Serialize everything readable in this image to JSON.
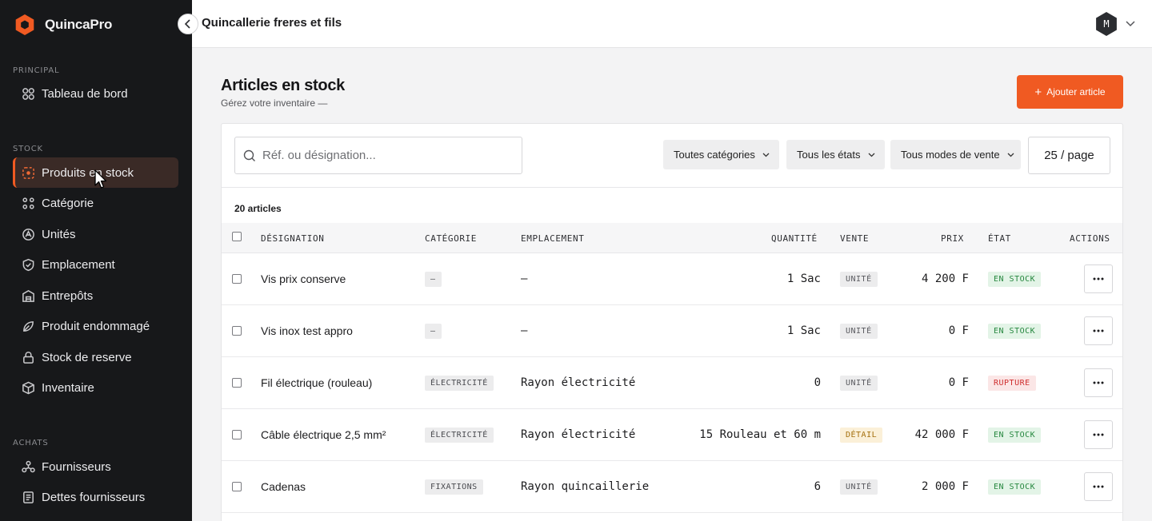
{
  "app": {
    "name": "QuincaPro",
    "brand_color": "#f05a22"
  },
  "header": {
    "store_name": "Quincallerie freres et fils",
    "avatar_initial": "M"
  },
  "sidebar": {
    "sections": [
      {
        "label": "PRINCIPAL",
        "items": [
          {
            "label": "Tableau de bord",
            "icon": "dashboard-icon"
          }
        ]
      },
      {
        "label": "STOCK",
        "items": [
          {
            "label": "Produits en stock",
            "icon": "box-icon",
            "active": true
          },
          {
            "label": "Catégorie",
            "icon": "category-icon"
          },
          {
            "label": "Unités",
            "icon": "units-icon"
          },
          {
            "label": "Emplacement",
            "icon": "location-icon"
          },
          {
            "label": "Entrepôts",
            "icon": "warehouse-icon"
          },
          {
            "label": "Produit endommagé",
            "icon": "damaged-icon"
          },
          {
            "label": "Stock de reserve",
            "icon": "lock-icon"
          },
          {
            "label": "Inventaire",
            "icon": "inventory-icon"
          }
        ]
      },
      {
        "label": "ACHATS",
        "items": [
          {
            "label": "Fournisseurs",
            "icon": "suppliers-icon"
          },
          {
            "label": "Dettes fournisseurs",
            "icon": "debts-icon"
          }
        ]
      }
    ]
  },
  "page": {
    "title": "Articles en stock",
    "subtitle": "Gérez votre inventaire —",
    "add_button": "Ajouter article"
  },
  "toolbar": {
    "search_placeholder": "Réf. ou désignation...",
    "filters": [
      "Toutes catégories",
      "Tous les états",
      "Tous modes de vente"
    ],
    "per_page": "25 / page"
  },
  "table": {
    "count_label": "20 articles",
    "columns": [
      "DÉSIGNATION",
      "CATÉGORIE",
      "EMPLACEMENT",
      "QUANTITÉ",
      "VENTE",
      "PRIX",
      "ÉTAT",
      "ACTIONS"
    ],
    "rows": [
      {
        "designation": "Vis prix conserve",
        "categorie": "—",
        "emplacement": "—",
        "quantite": "1 Sac",
        "vente": "UNITÉ",
        "prix": "4 200 F",
        "etat": "EN STOCK"
      },
      {
        "designation": "Vis inox test appro",
        "categorie": "—",
        "emplacement": "—",
        "quantite": "1 Sac",
        "vente": "UNITÉ",
        "prix": "0 F",
        "etat": "EN STOCK"
      },
      {
        "designation": "Fil électrique (rouleau)",
        "categorie": "ÉLECTRICITÉ",
        "emplacement": "Rayon électricité",
        "quantite": "0",
        "vente": "UNITÉ",
        "prix": "0 F",
        "etat": "RUPTURE"
      },
      {
        "designation": "Câble électrique 2,5 mm²",
        "categorie": "ÉLECTRICITÉ",
        "emplacement": "Rayon électricité",
        "quantite": "15 Rouleau et 60 m",
        "vente": "DÉTAIL",
        "prix": "42 000 F",
        "etat": "EN STOCK"
      },
      {
        "designation": "Cadenas",
        "categorie": "FIXATIONS",
        "emplacement": "Rayon quincaillerie",
        "quantite": "6",
        "vente": "UNITÉ",
        "prix": "2 000 F",
        "etat": "EN STOCK"
      }
    ]
  }
}
